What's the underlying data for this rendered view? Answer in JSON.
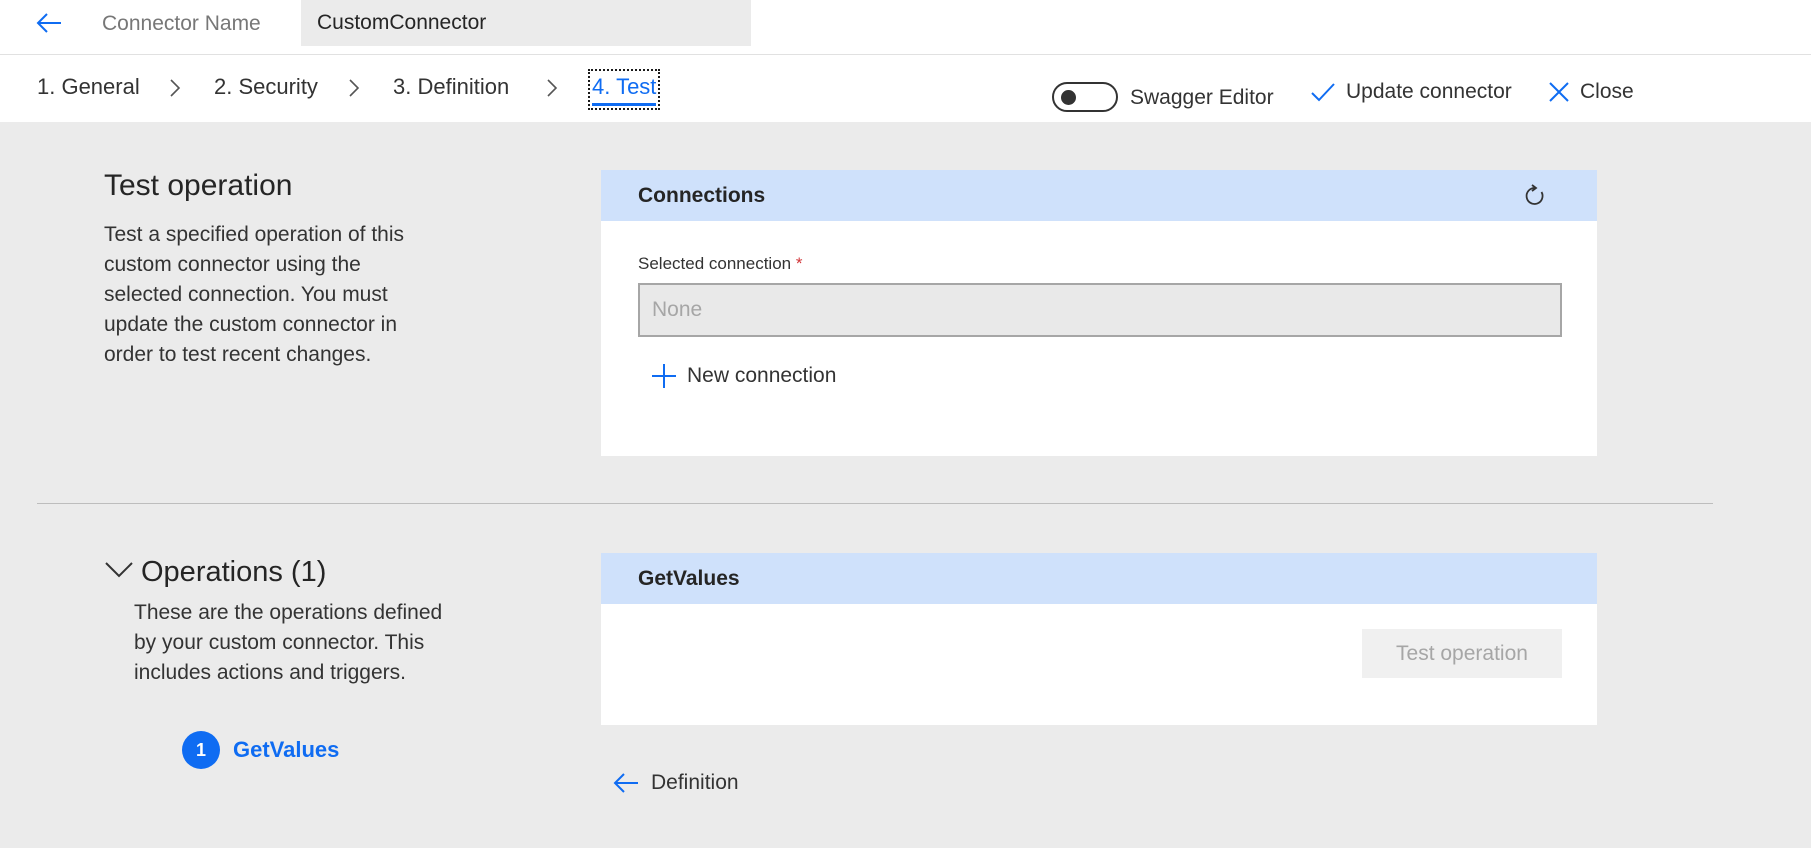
{
  "header": {
    "back_icon": "arrow-left-icon",
    "connector_name_label": "Connector Name",
    "connector_name_value": "CustomConnector"
  },
  "tabs": [
    {
      "label": "1. General"
    },
    {
      "label": "2. Security"
    },
    {
      "label": "3. Definition"
    },
    {
      "label": "4. Test",
      "active": true
    }
  ],
  "toolbar": {
    "swagger_label": "Swagger Editor",
    "swagger_on": false,
    "update_label": "Update connector",
    "close_label": "Close"
  },
  "test_section": {
    "title": "Test operation",
    "description": "Test a specified operation of this custom connector using the selected connection. You must update the custom connector in order to test recent changes."
  },
  "connections_card": {
    "title": "Connections",
    "selected_label": "Selected connection",
    "required_mark": "*",
    "selected_value": "None",
    "new_connection_label": "New connection"
  },
  "operations_section": {
    "title": "Operations (1)",
    "description": "These are the operations defined by your custom connector. This includes actions and triggers.",
    "items": [
      {
        "index": "1",
        "name": "GetValues"
      }
    ]
  },
  "operation_card": {
    "title": "GetValues",
    "test_button_label": "Test operation"
  },
  "footer": {
    "back_label": "Definition"
  },
  "colors": {
    "accent": "#0f6cf2",
    "card_header": "#cfe1fb",
    "background": "#ebebeb",
    "required": "#d13438"
  }
}
